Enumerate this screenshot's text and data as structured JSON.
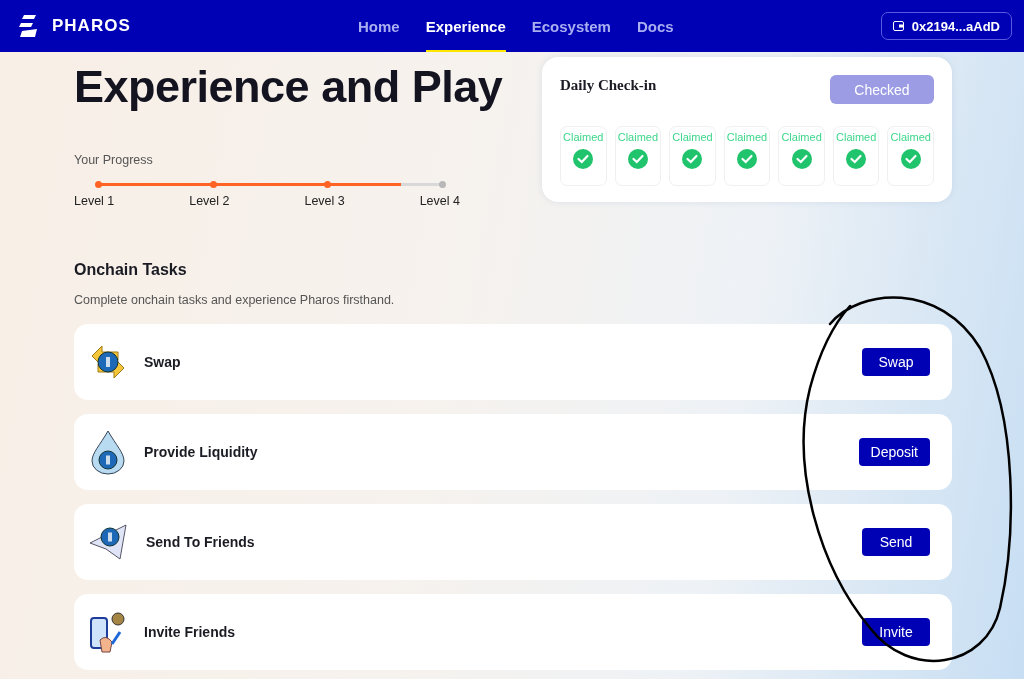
{
  "brand": {
    "name": "PHAROS"
  },
  "nav": [
    {
      "label": "Home",
      "selected": false
    },
    {
      "label": "Experience",
      "selected": true
    },
    {
      "label": "Ecosystem",
      "selected": false
    },
    {
      "label": "Docs",
      "selected": false
    }
  ],
  "wallet": {
    "address": "0x2194...aAdD"
  },
  "title": "Experience and Play",
  "progress": {
    "label": "Your Progress",
    "level": 0.88,
    "levels": [
      {
        "label": "Level 1",
        "reached": true
      },
      {
        "label": "Level 2",
        "reached": true
      },
      {
        "label": "Level 3",
        "reached": true
      },
      {
        "label": "Level 4",
        "reached": false
      }
    ]
  },
  "checkin": {
    "title": "Daily Check-in",
    "button": {
      "label": "Checked",
      "disabled": true
    },
    "days": [
      {
        "label": "Claimed",
        "claimed": true
      },
      {
        "label": "Claimed",
        "claimed": true
      },
      {
        "label": "Claimed",
        "claimed": true
      },
      {
        "label": "Claimed",
        "claimed": true
      },
      {
        "label": "Claimed",
        "claimed": true
      },
      {
        "label": "Claimed",
        "claimed": true
      },
      {
        "label": "Claimed",
        "claimed": true
      }
    ]
  },
  "tasks": {
    "title": "Onchain Tasks",
    "subtitle": "Complete onchain tasks and experience Pharos firsthand.",
    "items": [
      {
        "kind": "swap",
        "name": "Swap",
        "button": "Swap"
      },
      {
        "kind": "liquidity",
        "name": "Provide Liquidity",
        "button": "Deposit"
      },
      {
        "kind": "send",
        "name": "Send To Friends",
        "button": "Send"
      },
      {
        "kind": "invite",
        "name": "Invite Friends",
        "button": "Invite"
      }
    ]
  },
  "annotations": [
    {
      "kind": "freehand-ellipse"
    }
  ]
}
